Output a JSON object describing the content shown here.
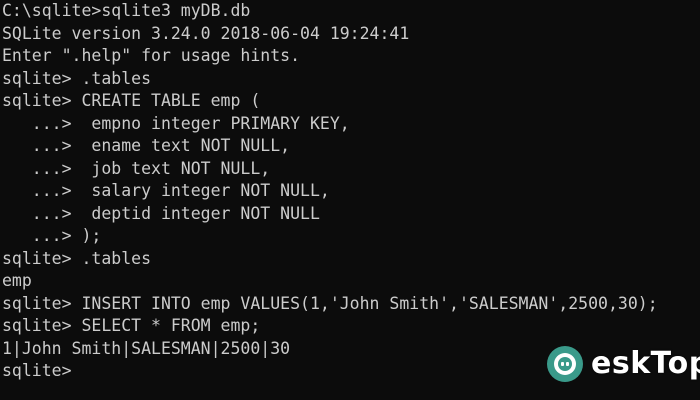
{
  "console": {
    "lines": [
      "C:\\sqlite>sqlite3 myDB.db",
      "SQLite version 3.24.0 2018-06-04 19:24:41",
      "Enter \".help\" for usage hints.",
      "sqlite> .tables",
      "sqlite> CREATE TABLE emp (",
      "   ...>  empno integer PRIMARY KEY,",
      "   ...>  ename text NOT NULL,",
      "   ...>  job text NOT NULL,",
      "   ...>  salary integer NOT NULL,",
      "   ...>  deptid integer NOT NULL",
      "   ...> );",
      "sqlite> .tables",
      "emp",
      "sqlite> INSERT INTO emp VALUES(1,'John Smith','SALESMAN',2500,30);",
      "sqlite> SELECT * FROM emp;",
      "1|John Smith|SALESMAN|2500|30",
      "sqlite>"
    ]
  },
  "watermark": {
    "text": "eskTop",
    "logo_icon": "desktop-logo-icon",
    "logo_color": "#3a9a8a"
  },
  "colors": {
    "background": "#0c0c0c",
    "text": "#cccccc"
  }
}
